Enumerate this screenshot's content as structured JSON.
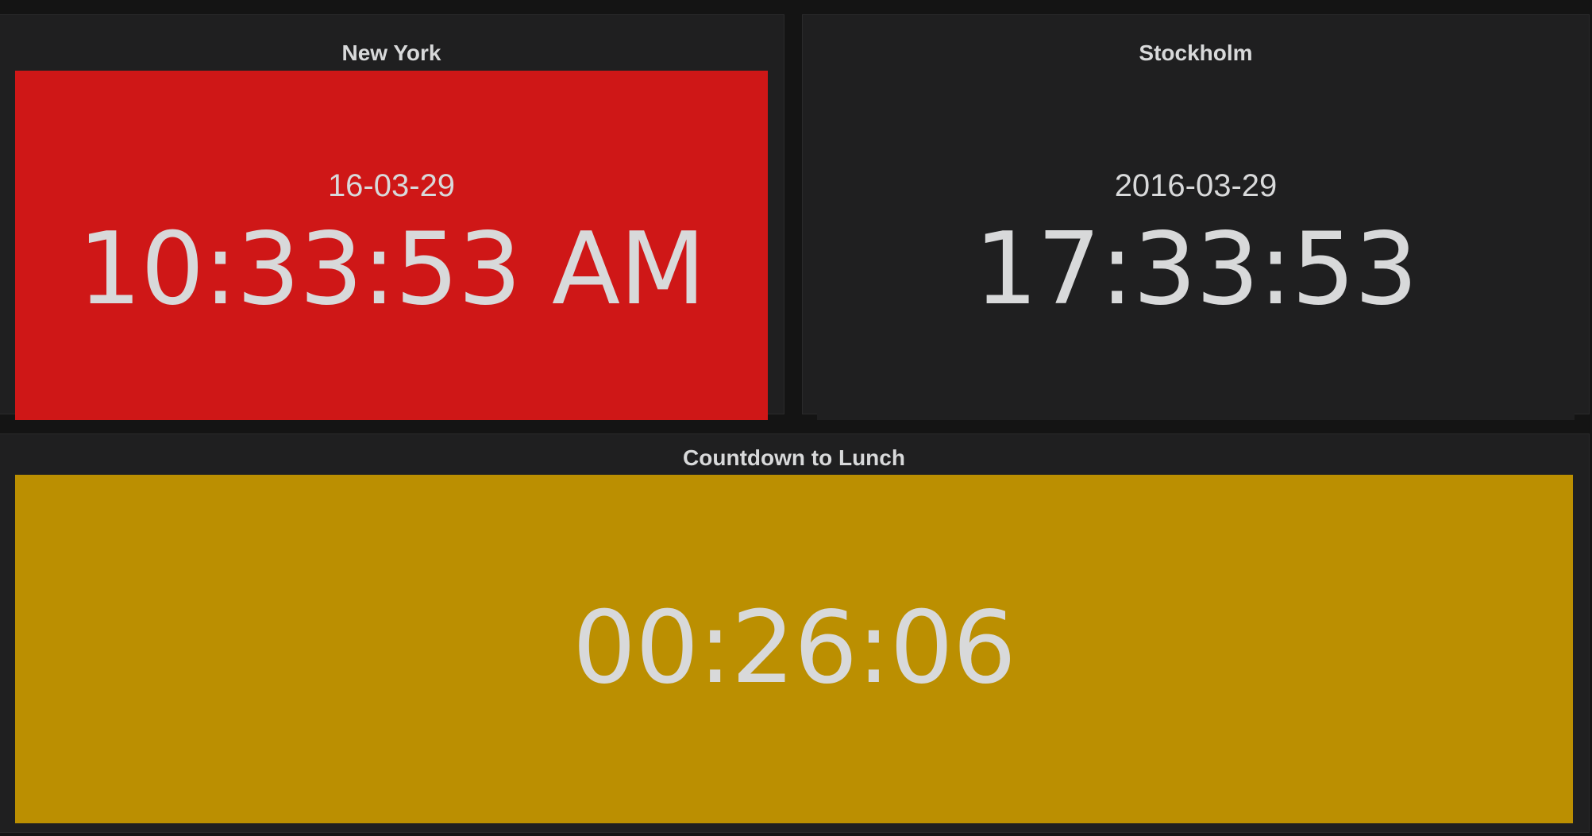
{
  "panels": {
    "new_york": {
      "title": "New York",
      "date": "16-03-29",
      "time": "10:33:53 AM",
      "background": "#cf1717"
    },
    "stockholm": {
      "title": "Stockholm",
      "date": "2016-03-29",
      "time": "17:33:53",
      "background": "#1f1f20"
    },
    "countdown": {
      "title": "Countdown to Lunch",
      "time": "00:26:06",
      "background": "#bb8f01"
    }
  },
  "colors": {
    "page_background": "#141414",
    "panel_background": "#1f1f20",
    "text": "#d8d9da"
  }
}
